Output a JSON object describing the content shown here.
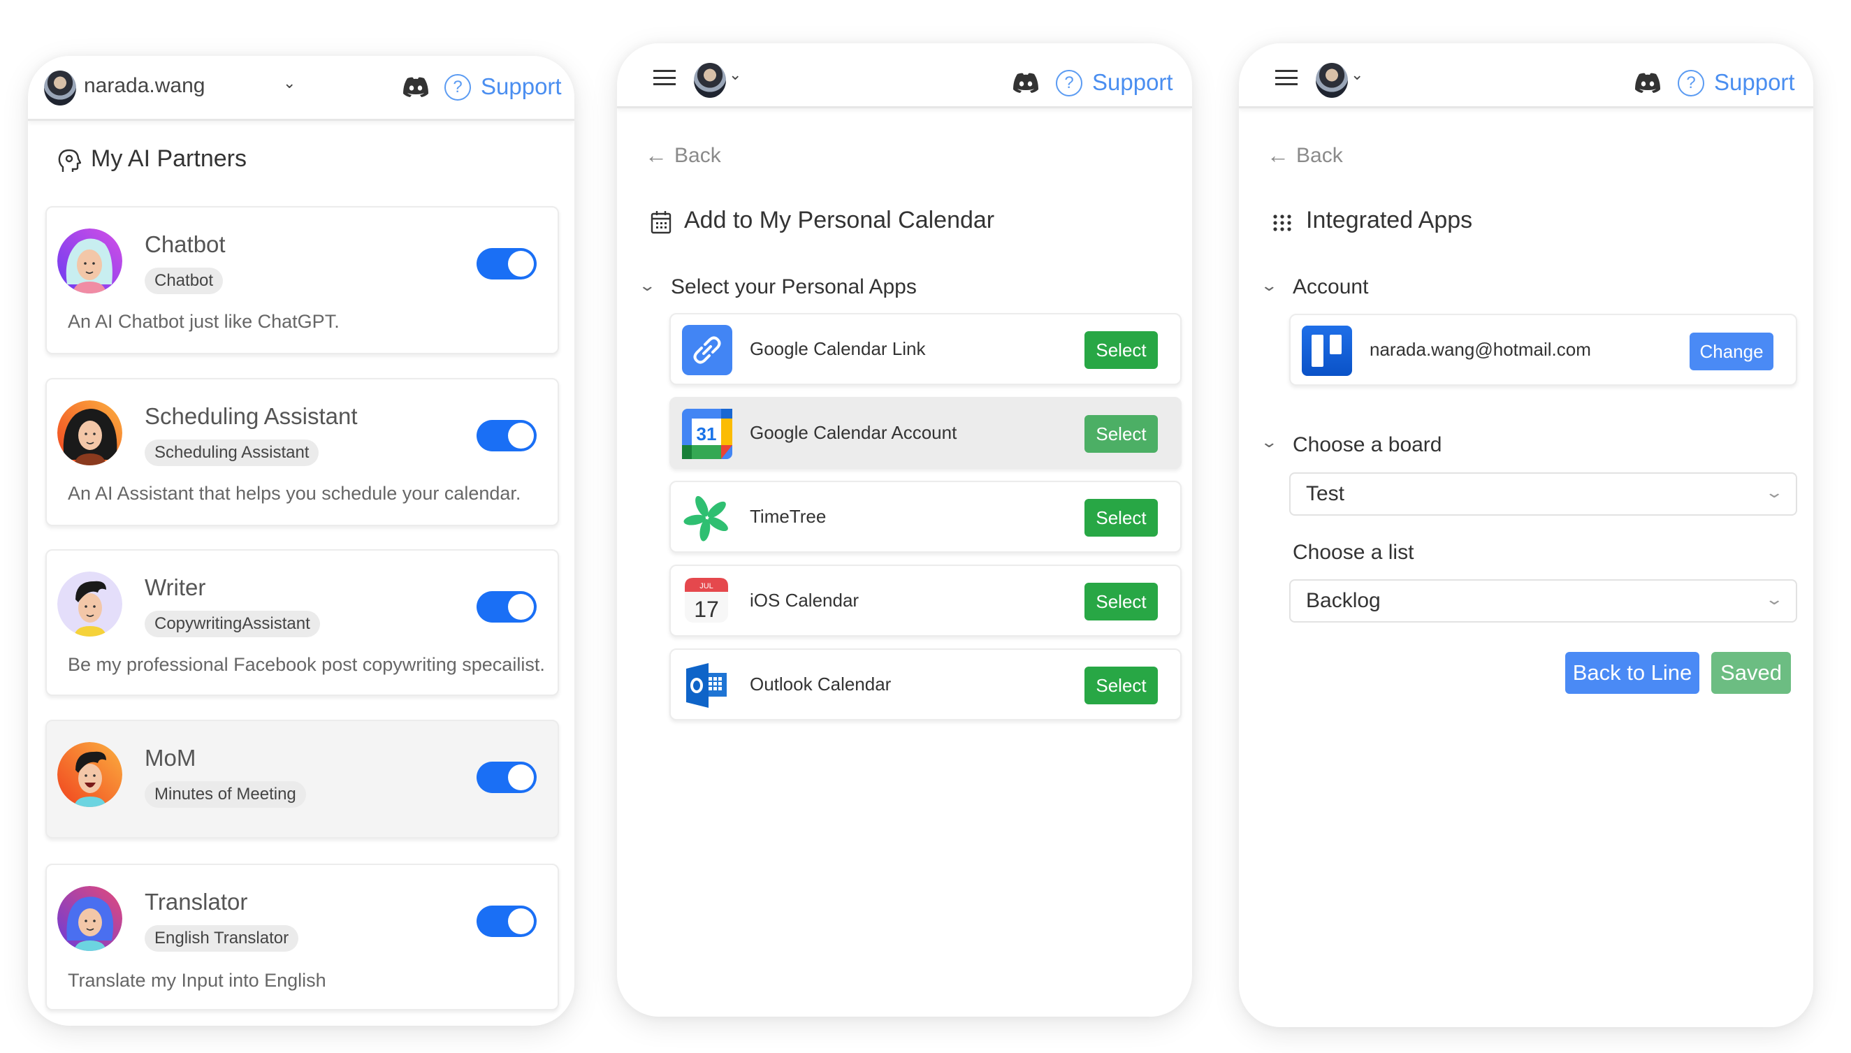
{
  "header": {
    "username": "narada.wang",
    "support_label": "Support"
  },
  "panel_partners": {
    "title": "My AI Partners",
    "partners": [
      {
        "name": "Chatbot",
        "tag": "Chatbot",
        "description": "An AI Chatbot just like ChatGPT.",
        "enabled": true
      },
      {
        "name": "Scheduling Assistant",
        "tag": "Scheduling Assistant",
        "description": "An AI Assistant that helps you schedule your calendar.",
        "enabled": true
      },
      {
        "name": "Writer",
        "tag": "CopywritingAssistant",
        "description": "Be my professional Facebook post copywriting specailist.",
        "enabled": true
      },
      {
        "name": "MoM",
        "tag": "Minutes of Meeting",
        "description": "",
        "enabled": true
      },
      {
        "name": "Translator",
        "tag": "English Translator",
        "description": "Translate my Input into English",
        "enabled": true
      }
    ]
  },
  "panel_calendar": {
    "back_label": "Back",
    "title": "Add to My Personal Calendar",
    "section_label": "Select your Personal Apps",
    "apps": [
      {
        "name": "Google Calendar Link",
        "button": "Select",
        "icon": "link-icon"
      },
      {
        "name": "Google Calendar Account",
        "button": "Select",
        "icon": "google-calendar-icon",
        "calendar_day": "31"
      },
      {
        "name": "TimeTree",
        "button": "Select",
        "icon": "timetree-icon"
      },
      {
        "name": "iOS Calendar",
        "button": "Select",
        "icon": "ios-calendar-icon",
        "month": "JUL",
        "day": "17"
      },
      {
        "name": "Outlook Calendar",
        "button": "Select",
        "icon": "outlook-icon"
      }
    ]
  },
  "panel_integrated": {
    "back_label": "Back",
    "title": "Integrated Apps",
    "account_label": "Account",
    "account_email": "narada.wang@hotmail.com",
    "change_label": "Change",
    "board_label": "Choose a board",
    "board_value": "Test",
    "list_label": "Choose a list",
    "list_value": "Backlog",
    "back_to_line_label": "Back to Line",
    "saved_label": "Saved"
  },
  "colors": {
    "toggle_on": "#1a6ff5",
    "select_green": "#28a745",
    "primary_blue": "#4a8af5",
    "support_blue": "#4a8ef0",
    "saved_green": "#6cbd82"
  }
}
